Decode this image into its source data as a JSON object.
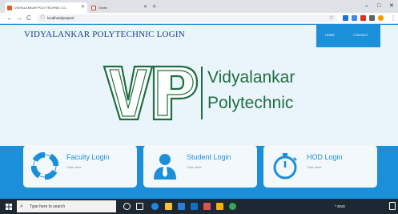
{
  "browser": {
    "tabs": [
      {
        "label": "VIDYALANKAR POLYTECHNIC LO..."
      },
      {
        "label": "Gmail"
      }
    ],
    "new_tab_symbol": "+",
    "window_controls": {
      "minimize": "–",
      "maximize": "□",
      "close": "✕"
    },
    "nav": {
      "back": "←",
      "forward": "→",
      "reload": "C"
    },
    "address": {
      "info_symbol": "ⓘ",
      "url": "localhost/project/",
      "star_symbol": "☆"
    }
  },
  "site": {
    "title": "VIDYALANKAR POLYTECHNIC LOGIN",
    "nav": [
      {
        "label": "HOME"
      },
      {
        "label": "CONTACT"
      }
    ],
    "logo": {
      "monogram": "VP",
      "line1": "Vidyalankar",
      "line2": "Polytechnic",
      "color": "#1e6f3f"
    },
    "cards": [
      {
        "title": "Faculty Login",
        "subtitle": "Click Here",
        "icon": "lifebuoy-icon"
      },
      {
        "title": "Student Login",
        "subtitle": "Click Here",
        "icon": "person-tie-icon"
      },
      {
        "title": "HOD Login",
        "subtitle": "Click Here",
        "icon": "stopwatch-icon"
      }
    ]
  },
  "taskbar": {
    "search_placeholder": "Type here to search",
    "tray_text": "^ ENG",
    "clock_time": "",
    "clock_date": ""
  },
  "colors": {
    "accent": "#1b8fd9",
    "page_bg": "#eaf4fb",
    "title_blue": "#1a3a8f",
    "logo_green": "#1e6f3f"
  }
}
